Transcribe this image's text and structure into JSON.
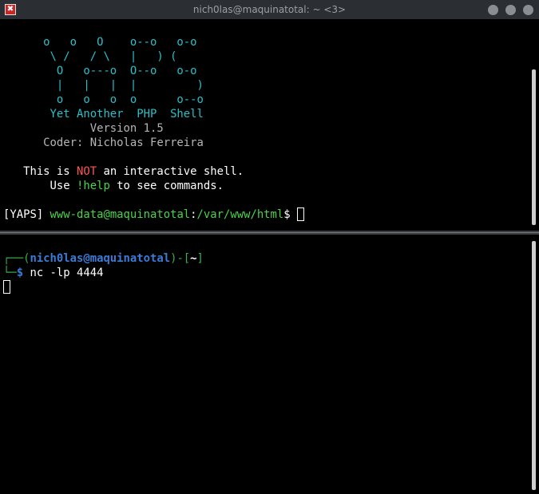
{
  "window": {
    "title": "nich0las@maquinatotal: ~ <3>",
    "app_icon_glyph": "✖"
  },
  "top_pane": {
    "banner": {
      "art_line_1": "      o   o   O    o--o   o-o",
      "art_line_2": "       \\ /   / \\   |   ) (",
      "art_line_3": "        O   o---o  O--o   o-o",
      "art_line_4": "        |   |   |  |         )",
      "art_line_5": "        o   o   o  o      o--o",
      "name_line": "       Yet Another  PHP  Shell",
      "version_line": "             Version 1.5",
      "coder_line": "      Coder: Nicholas Ferreira"
    },
    "notice": {
      "prefix": "   This is ",
      "highlight": "NOT",
      "suffix": " an interactive shell."
    },
    "help": {
      "prefix": "       Use ",
      "command": "!help",
      "suffix": " to see commands."
    },
    "prompt": {
      "tag": "[YAPS] ",
      "user_host": "www-data@maquinatotal",
      "separator": ":",
      "path": "/var/www/html",
      "symbol": "$ "
    }
  },
  "bottom_pane": {
    "prompt": {
      "corner_top": "┌──(",
      "user_host": "nich0las@maquinatotal",
      "close_paren": ")-[",
      "dir": "~",
      "close_bracket": "]",
      "corner_bottom": "└─",
      "symbol": "$ ",
      "command": "nc -lp 4444"
    }
  }
}
